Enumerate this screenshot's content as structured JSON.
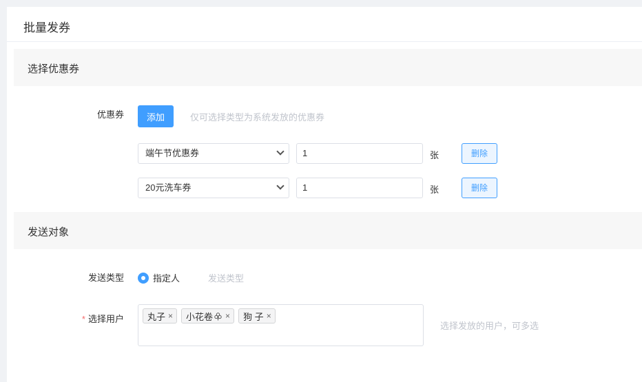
{
  "page": {
    "title": "批量发券"
  },
  "section_coupon": {
    "title": "选择优惠券",
    "coupon_label": "优惠券",
    "add_label": "添加",
    "hint": "仅可选择类型为系统发放的优惠券",
    "rows": [
      {
        "coupon": "端午节优惠券",
        "quantity": "1",
        "unit": "张",
        "delete_label": "删除"
      },
      {
        "coupon": "20元洗车券",
        "quantity": "1",
        "unit": "张",
        "delete_label": "删除"
      }
    ]
  },
  "section_target": {
    "title": "发送对象",
    "send_type_label": "发送类型",
    "send_type_selected": "指定人",
    "send_type_other": "发送类型",
    "users_required_mark": "*",
    "users_label": "选择用户",
    "users": [
      "丸子",
      "小花卷",
      "狗 子"
    ],
    "users_hint": "选择发放的用户，可多选"
  },
  "colors": {
    "primary": "#409eff",
    "required": "#f56c6c",
    "hint": "#c0c4cc"
  }
}
